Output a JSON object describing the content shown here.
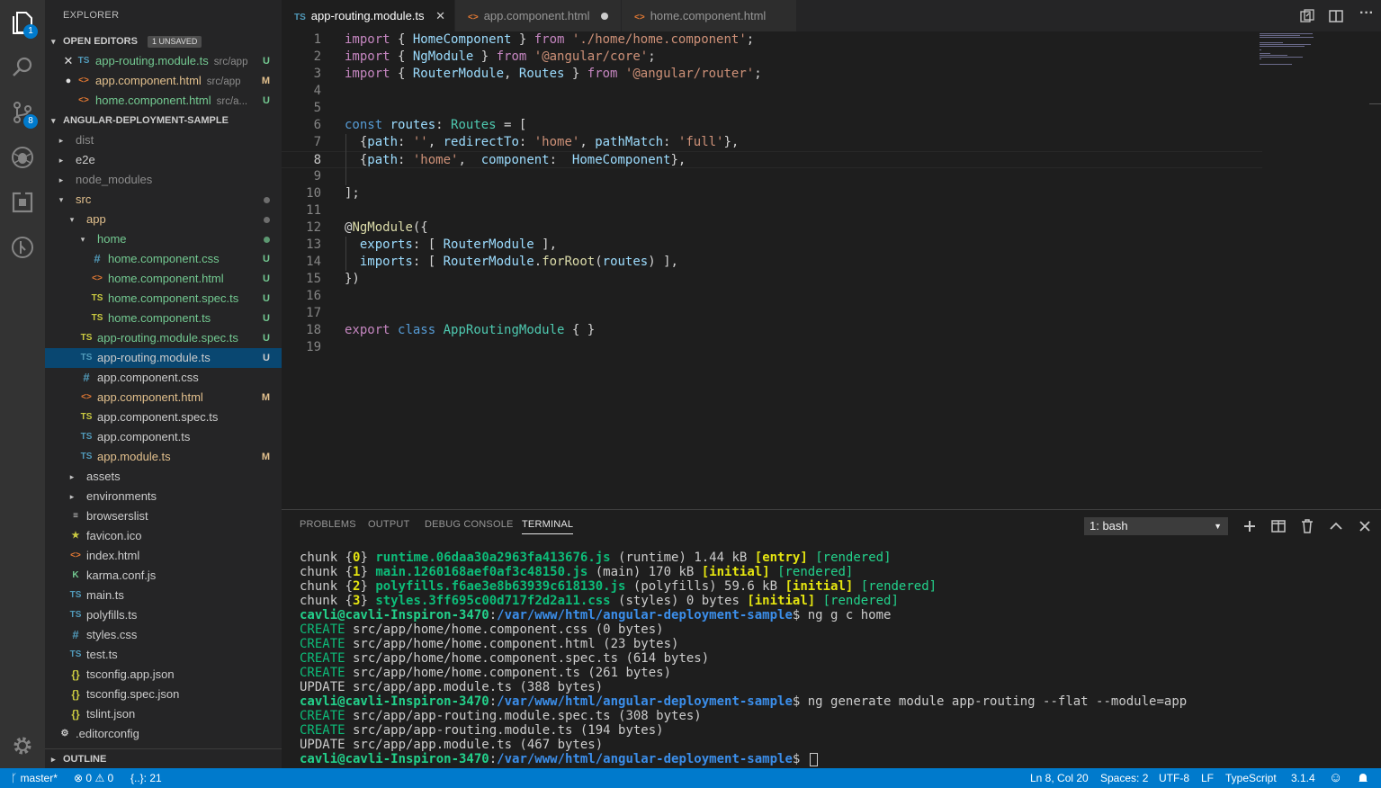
{
  "activity_bar": {
    "explorer_badge": "1",
    "scm_badge": "8"
  },
  "sidebar": {
    "title": "EXPLORER",
    "open_editors": {
      "title": "OPEN EDITORS",
      "badge": "1 UNSAVED",
      "items": [
        {
          "icon": "TS",
          "name": "app-routing.module.ts",
          "desc": "src/app",
          "status": "U",
          "lead": "✕"
        },
        {
          "icon": "<>",
          "name": "app.component.html",
          "desc": "src/app",
          "status": "M",
          "lead": "●"
        },
        {
          "icon": "<>",
          "name": "home.component.html",
          "desc": "src/a...",
          "status": "U",
          "lead": ""
        }
      ]
    },
    "project": {
      "title": "ANGULAR-DEPLOYMENT-SAMPLE",
      "items": [
        {
          "name": "dist",
          "twisty": "▸",
          "icon": ""
        },
        {
          "name": "e2e",
          "twisty": "▸",
          "icon": ""
        },
        {
          "name": "node_modules",
          "twisty": "▸",
          "icon": ""
        },
        {
          "name": "src",
          "twisty": "▾",
          "icon": ""
        },
        {
          "name": "app",
          "twisty": "▾",
          "icon": ""
        },
        {
          "name": "home",
          "twisty": "▾",
          "icon": ""
        },
        {
          "name": "home.component.css",
          "icon": "#",
          "status": "U"
        },
        {
          "name": "home.component.html",
          "icon": "<>",
          "status": "U"
        },
        {
          "name": "home.component.spec.ts",
          "icon": "TS",
          "status": "U"
        },
        {
          "name": "home.component.ts",
          "icon": "TS",
          "status": "U"
        },
        {
          "name": "app-routing.module.spec.ts",
          "icon": "TS",
          "status": "U"
        },
        {
          "name": "app-routing.module.ts",
          "icon": "TS",
          "status": "U"
        },
        {
          "name": "app.component.css",
          "icon": "#",
          "status": ""
        },
        {
          "name": "app.component.html",
          "icon": "<>",
          "status": "M"
        },
        {
          "name": "app.component.spec.ts",
          "icon": "TS",
          "status": ""
        },
        {
          "name": "app.component.ts",
          "icon": "TS",
          "status": ""
        },
        {
          "name": "app.module.ts",
          "icon": "TS",
          "status": "M"
        },
        {
          "name": "assets",
          "twisty": "▸",
          "icon": ""
        },
        {
          "name": "environments",
          "twisty": "▸",
          "icon": ""
        },
        {
          "name": "browserslist",
          "icon": "≡"
        },
        {
          "name": "favicon.ico",
          "icon": "★"
        },
        {
          "name": "index.html",
          "icon": "<>"
        },
        {
          "name": "karma.conf.js",
          "icon": "K"
        },
        {
          "name": "main.ts",
          "icon": "TS"
        },
        {
          "name": "polyfills.ts",
          "icon": "TS"
        },
        {
          "name": "styles.css",
          "icon": "#"
        },
        {
          "name": "test.ts",
          "icon": "TS"
        },
        {
          "name": "tsconfig.app.json",
          "icon": "{}"
        },
        {
          "name": "tsconfig.spec.json",
          "icon": "{}"
        },
        {
          "name": "tslint.json",
          "icon": "{}"
        },
        {
          "name": ".editorconfig",
          "icon": "⚙"
        }
      ]
    },
    "outline_title": "OUTLINE"
  },
  "tabs": [
    {
      "icon": "TS",
      "label": "app-routing.module.ts",
      "active": true,
      "close": "✕"
    },
    {
      "icon": "<>",
      "label": "app.component.html",
      "active": false
    },
    {
      "icon": "<>",
      "label": "home.component.html",
      "active": false
    }
  ],
  "editor": {
    "current_line": 8,
    "lines": [
      [
        [
          "kw",
          "import"
        ],
        [
          "p",
          " { "
        ],
        [
          "var",
          "HomeComponent"
        ],
        [
          "p",
          " } "
        ],
        [
          "kw",
          "from"
        ],
        [
          "p",
          " "
        ],
        [
          "str",
          "'./home/home.component'"
        ],
        [
          "p",
          ";"
        ]
      ],
      [
        [
          "kw",
          "import"
        ],
        [
          "p",
          " { "
        ],
        [
          "var",
          "NgModule"
        ],
        [
          "p",
          " } "
        ],
        [
          "kw",
          "from"
        ],
        [
          "p",
          " "
        ],
        [
          "str",
          "'@angular/core'"
        ],
        [
          "p",
          ";"
        ]
      ],
      [
        [
          "kw",
          "import"
        ],
        [
          "p",
          " { "
        ],
        [
          "var",
          "RouterModule"
        ],
        [
          "p",
          ", "
        ],
        [
          "var",
          "Routes"
        ],
        [
          "p",
          " } "
        ],
        [
          "kw",
          "from"
        ],
        [
          "p",
          " "
        ],
        [
          "str",
          "'@angular/router'"
        ],
        [
          "p",
          ";"
        ]
      ],
      [],
      [],
      [
        [
          "kw2",
          "const"
        ],
        [
          "p",
          " "
        ],
        [
          "var",
          "routes"
        ],
        [
          "p",
          ": "
        ],
        [
          "cls",
          "Routes"
        ],
        [
          "p",
          " = ["
        ]
      ],
      [
        [
          "p",
          "  {"
        ],
        [
          "var",
          "path"
        ],
        [
          "p",
          ": "
        ],
        [
          "str",
          "''"
        ],
        [
          "p",
          ", "
        ],
        [
          "var",
          "redirectTo"
        ],
        [
          "p",
          ": "
        ],
        [
          "str",
          "'home'"
        ],
        [
          "p",
          ", "
        ],
        [
          "var",
          "pathMatch"
        ],
        [
          "p",
          ": "
        ],
        [
          "str",
          "'full'"
        ],
        [
          "p",
          "},"
        ]
      ],
      [
        [
          "p",
          "  {"
        ],
        [
          "var",
          "path"
        ],
        [
          "p",
          ": "
        ],
        [
          "str",
          "'home'"
        ],
        [
          "p",
          ",  "
        ],
        [
          "var",
          "component"
        ],
        [
          "p",
          ":  "
        ],
        [
          "var",
          "HomeComponent"
        ],
        [
          "p",
          "},"
        ]
      ],
      [],
      [
        [
          "p",
          "];"
        ]
      ],
      [],
      [
        [
          "p",
          "@"
        ],
        [
          "fn",
          "NgModule"
        ],
        [
          "p",
          "({"
        ]
      ],
      [
        [
          "p",
          "  "
        ],
        [
          "var",
          "exports"
        ],
        [
          "p",
          ": [ "
        ],
        [
          "var",
          "RouterModule"
        ],
        [
          "p",
          " ],"
        ]
      ],
      [
        [
          "p",
          "  "
        ],
        [
          "var",
          "imports"
        ],
        [
          "p",
          ": [ "
        ],
        [
          "var",
          "RouterModule"
        ],
        [
          "p",
          "."
        ],
        [
          "fn",
          "forRoot"
        ],
        [
          "p",
          "("
        ],
        [
          "var",
          "routes"
        ],
        [
          "p",
          ") ],"
        ]
      ],
      [
        [
          "p",
          "})"
        ]
      ],
      [],
      [],
      [
        [
          "kw",
          "export"
        ],
        [
          "p",
          " "
        ],
        [
          "kw2",
          "class"
        ],
        [
          "p",
          " "
        ],
        [
          "cls",
          "AppRoutingModule"
        ],
        [
          "p",
          " { }"
        ]
      ],
      []
    ]
  },
  "panel": {
    "tabs": [
      "PROBLEMS",
      "OUTPUT",
      "DEBUG CONSOLE",
      "TERMINAL"
    ],
    "active_tab": "TERMINAL",
    "terminal_select": "1: bash",
    "terminal_lines": [
      [
        [
          "p",
          "chunk {"
        ],
        [
          "y",
          "0"
        ],
        [
          "p",
          "} "
        ],
        [
          "g",
          "runtime.06daa30a2963fa413676.js"
        ],
        [
          "p",
          " (runtime) 1.44 kB "
        ],
        [
          "y",
          "[entry]"
        ],
        [
          "p",
          " "
        ],
        [
          "gb",
          "[rendered]"
        ]
      ],
      [
        [
          "p",
          "chunk {"
        ],
        [
          "y",
          "1"
        ],
        [
          "p",
          "} "
        ],
        [
          "g",
          "main.1260168aef0af3c48150.js"
        ],
        [
          "p",
          " (main) 170 kB "
        ],
        [
          "y",
          "[initial]"
        ],
        [
          "p",
          " "
        ],
        [
          "gb",
          "[rendered]"
        ]
      ],
      [
        [
          "p",
          "chunk {"
        ],
        [
          "y",
          "2"
        ],
        [
          "p",
          "} "
        ],
        [
          "g",
          "polyfills.f6ae3e8b63939c618130.js"
        ],
        [
          "p",
          " (polyfills) 59.6 kB "
        ],
        [
          "y",
          "[initial]"
        ],
        [
          "p",
          " "
        ],
        [
          "gb",
          "[rendered]"
        ]
      ],
      [
        [
          "p",
          "chunk {"
        ],
        [
          "y",
          "3"
        ],
        [
          "p",
          "} "
        ],
        [
          "g",
          "styles.3ff695c00d717f2d2a11.css"
        ],
        [
          "p",
          " (styles) 0 bytes "
        ],
        [
          "y",
          "[initial]"
        ],
        [
          "p",
          " "
        ],
        [
          "gb",
          "[rendered]"
        ]
      ],
      [
        [
          "h",
          "cavli@cavli-Inspiron-3470"
        ],
        [
          "p",
          ":"
        ],
        [
          "b",
          "/var/www/html/angular-deployment-sample"
        ],
        [
          "p",
          "$ ng g c home"
        ]
      ],
      [
        [
          "gn",
          "CREATE"
        ],
        [
          "p",
          " src/app/home/home.component.css (0 bytes)"
        ]
      ],
      [
        [
          "gn",
          "CREATE"
        ],
        [
          "p",
          " src/app/home/home.component.html (23 bytes)"
        ]
      ],
      [
        [
          "gn",
          "CREATE"
        ],
        [
          "p",
          " src/app/home/home.component.spec.ts (614 bytes)"
        ]
      ],
      [
        [
          "gn",
          "CREATE"
        ],
        [
          "p",
          " src/app/home/home.component.ts (261 bytes)"
        ]
      ],
      [
        [
          "p",
          "UPDATE src/app/app.module.ts (388 bytes)"
        ]
      ],
      [
        [
          "h",
          "cavli@cavli-Inspiron-3470"
        ],
        [
          "p",
          ":"
        ],
        [
          "b",
          "/var/www/html/angular-deployment-sample"
        ],
        [
          "p",
          "$ ng generate module app-routing --flat --module=app"
        ]
      ],
      [
        [
          "gn",
          "CREATE"
        ],
        [
          "p",
          " src/app/app-routing.module.spec.ts (308 bytes)"
        ]
      ],
      [
        [
          "gn",
          "CREATE"
        ],
        [
          "p",
          " src/app/app-routing.module.ts (194 bytes)"
        ]
      ],
      [
        [
          "p",
          "UPDATE src/app/app.module.ts (467 bytes)"
        ]
      ],
      [
        [
          "h",
          "cavli@cavli-Inspiron-3470"
        ],
        [
          "p",
          ":"
        ],
        [
          "b",
          "/var/www/html/angular-deployment-sample"
        ],
        [
          "p",
          "$ "
        ],
        [
          "cur",
          ""
        ]
      ]
    ]
  },
  "statusbar": {
    "branch": "master*",
    "errors": "0",
    "warnings": "0",
    "symbols": "{..}: 21",
    "position": "Ln 8, Col 20",
    "spaces": "Spaces: 2",
    "encoding": "UTF-8",
    "eol": "LF",
    "language": "TypeScript",
    "version": "3.1.4"
  }
}
